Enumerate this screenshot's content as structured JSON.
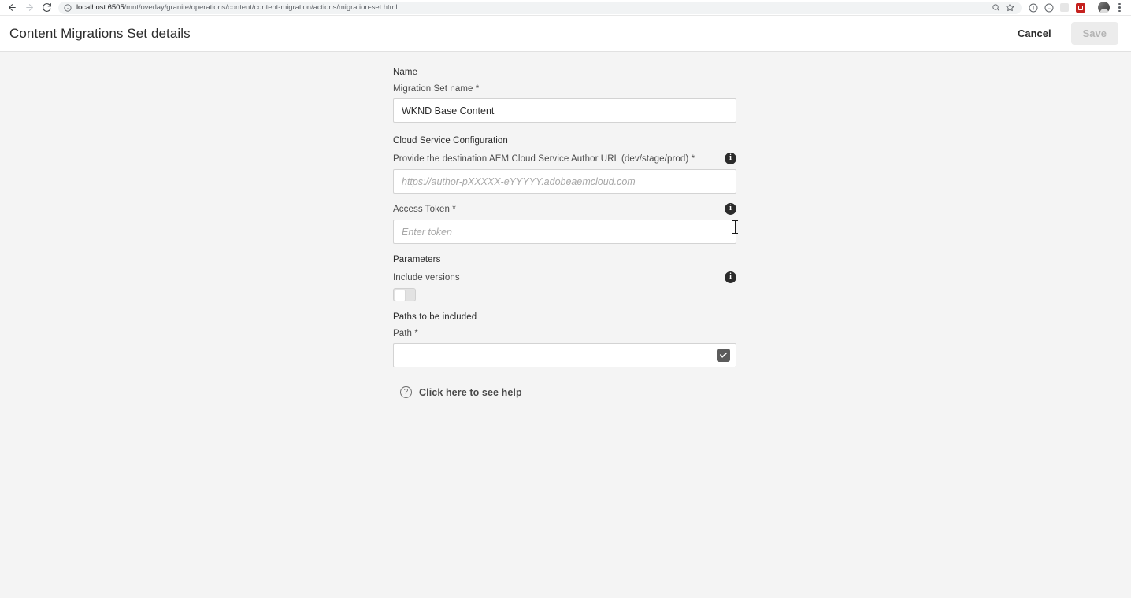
{
  "browser": {
    "url_prefix": "localhost:6505",
    "url_suffix": "/mnt/overlay/granite/operations/content/content-migration/actions/migration-set.html",
    "back_icon": "back-arrow-icon",
    "forward_icon": "forward-arrow-icon",
    "reload_icon": "reload-icon",
    "site_info_icon": "site-info-icon",
    "zoom_icon": "zoom-search-icon",
    "bookmark_icon": "star-bookmark-icon",
    "ext_info_icon": "extension-info-icon",
    "ext_face_icon": "extension-face-icon",
    "ext_blank_icon": "extension-blank-icon",
    "ext_red_icon": "extension-red-icon",
    "avatar_icon": "profile-avatar",
    "menu_icon": "kebab-menu-icon"
  },
  "header": {
    "title": "Content Migrations Set details",
    "cancel_label": "Cancel",
    "save_label": "Save"
  },
  "form": {
    "name_section": {
      "title": "Name",
      "field_label": "Migration Set name *",
      "value": "WKND Base Content",
      "placeholder": ""
    },
    "cloud_section": {
      "title": "Cloud Service Configuration",
      "url_label": "Provide the destination AEM Cloud Service Author URL (dev/stage/prod) *",
      "url_value": "",
      "url_placeholder": "https://author-pXXXXX-eYYYYY.adobeaemcloud.com",
      "token_label": "Access Token *",
      "token_value": "",
      "token_placeholder": "Enter token",
      "info_glyph": "i"
    },
    "parameters_section": {
      "title": "Parameters",
      "include_versions_label": "Include versions",
      "include_versions_state": "off",
      "info_glyph": "i"
    },
    "paths_section": {
      "title": "Paths to be included",
      "field_label": "Path *",
      "value": "",
      "placeholder": "",
      "picker_icon": "checkbox-checked-icon"
    },
    "help": {
      "label": "Click here to see help",
      "icon_glyph": "?"
    }
  },
  "colors": {
    "page_bg": "#f4f4f4",
    "header_bg": "#ffffff",
    "input_border": "#d3d3d3",
    "info_icon": "#2b2b2b",
    "picker_button": "#5c5c5c",
    "save_disabled_bg": "#ececec"
  }
}
